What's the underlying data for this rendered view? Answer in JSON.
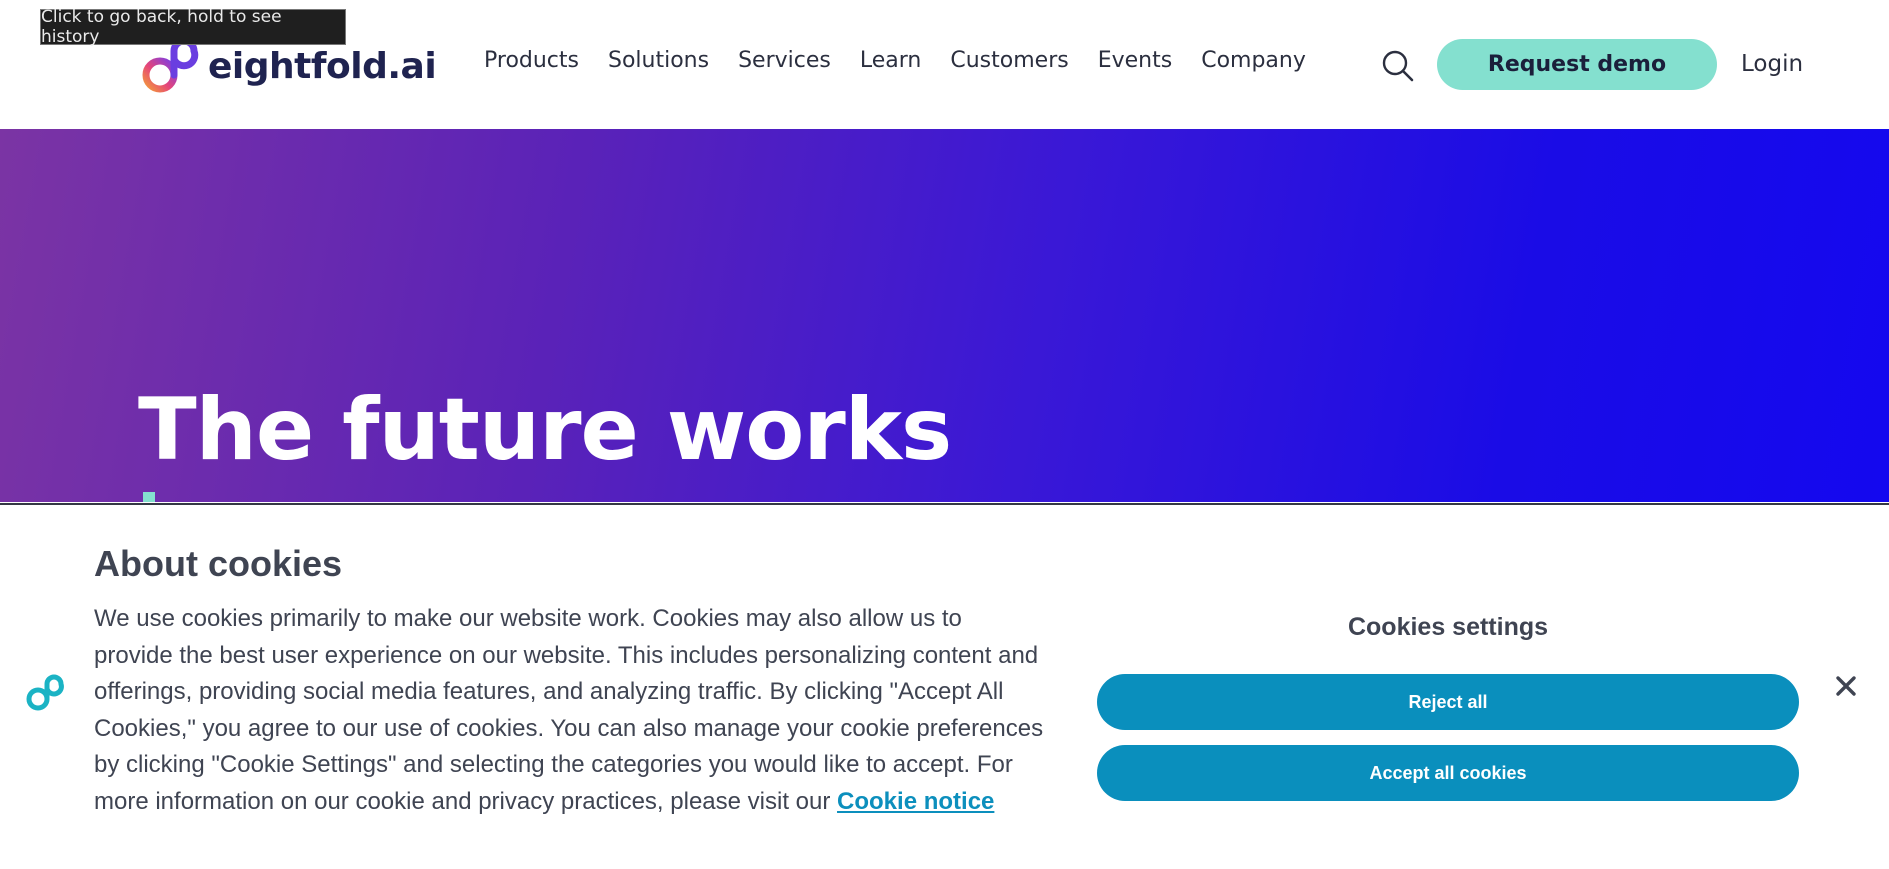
{
  "tooltip": {
    "text": "Click to go back, hold to see history"
  },
  "header": {
    "logo_text": "eightfold.ai",
    "nav": [
      "Products",
      "Solutions",
      "Services",
      "Learn",
      "Customers",
      "Events",
      "Company"
    ],
    "search_icon": "search-icon",
    "demo_label": "Request demo",
    "login_label": "Login"
  },
  "hero": {
    "title": "The future works"
  },
  "cookies": {
    "title": "About cookies",
    "body": "We use cookies primarily to make our website work. Cookies may also allow us to provide the best user experience on our website. This includes personalizing content and offerings, providing social media features, and analyzing traffic. By clicking \"Accept All Cookies,\" you agree to our use of cookies. You can also manage your cookie preferences by clicking \"Cookie Settings\" and selecting the categories you would like to accept. For more information on our cookie and privacy practices, please visit our",
    "link_text": "Cookie notice",
    "settings_label": "Cookies settings",
    "reject_label": "Reject all",
    "accept_label": "Accept all cookies"
  },
  "colors": {
    "accent": "#84e0cf",
    "cookie_button": "#0a8fbd",
    "hero_start": "#7b34a4",
    "hero_end": "#1408ef"
  }
}
